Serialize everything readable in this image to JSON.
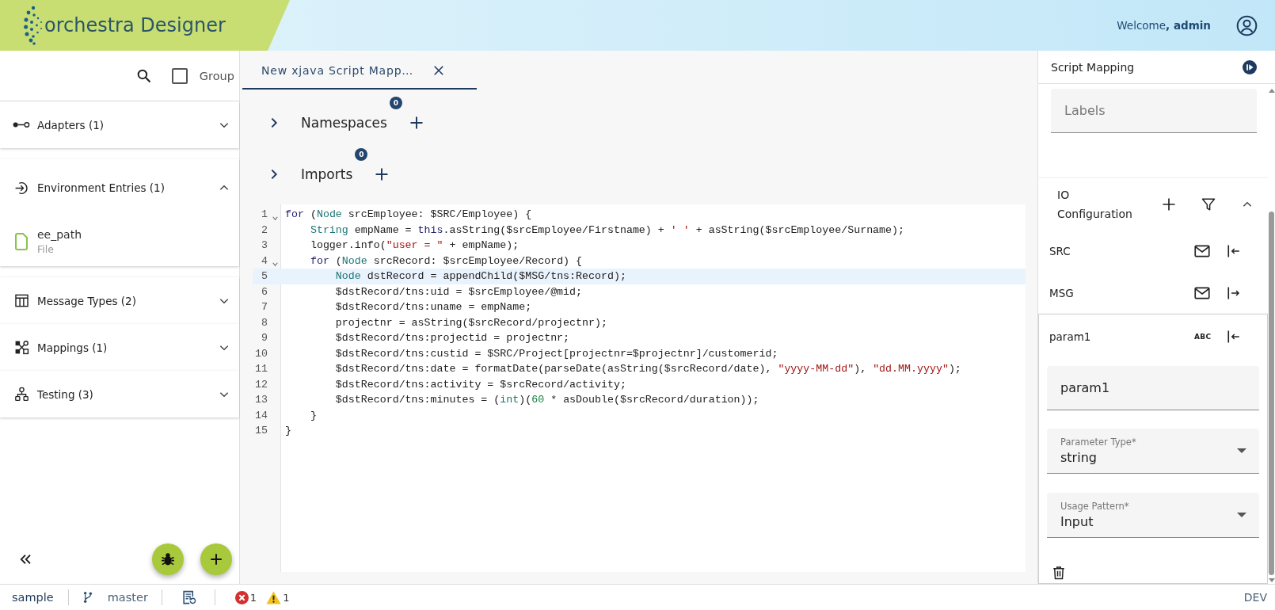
{
  "header": {
    "app_name": "orchestra Designer",
    "welcome": "Welcome**, admin**"
  },
  "sidebar": {
    "group_toggle": {
      "label": "Group",
      "checked": false
    },
    "sections": [
      {
        "title": "Adapters (1)",
        "expanded": false
      },
      {
        "title": "Environment Entries (1)",
        "expanded": true,
        "entries": [
          {
            "name": "ee_path",
            "type": "File"
          }
        ]
      },
      {
        "title": "Message Types (2)",
        "expanded": false
      },
      {
        "title": "Mappings (1)",
        "expanded": false
      },
      {
        "title": "Testing (3)",
        "expanded": false
      }
    ]
  },
  "editor": {
    "tabs": [
      {
        "label": "New xjava Script Mapp…",
        "selected": true
      }
    ],
    "sections": [
      {
        "label": "Namespaces",
        "count": "0",
        "expanded": false
      },
      {
        "label": "Imports",
        "count": "0",
        "expanded": false
      }
    ],
    "lines": [
      {
        "number": "1",
        "foldable": true,
        "active": false,
        "tokens": [
          {
            "text": "for",
            "kind": "keyword"
          },
          {
            "text": " (",
            "kind": "plain"
          },
          {
            "text": "Node",
            "kind": "type"
          },
          {
            "text": " srcEmployee: $SRC/Employee) {",
            "kind": "plain"
          }
        ]
      },
      {
        "number": "2",
        "foldable": false,
        "active": false,
        "tokens": [
          {
            "text": "    String",
            "kind": "type"
          },
          {
            "text": " empName = ",
            "kind": "plain"
          },
          {
            "text": "this",
            "kind": "keyword"
          },
          {
            "text": ".asString($srcEmployee/Firstname) + ",
            "kind": "plain"
          },
          {
            "text": "' '",
            "kind": "string"
          },
          {
            "text": " + asString($srcEmployee/Surname);",
            "kind": "plain"
          }
        ]
      },
      {
        "number": "3",
        "foldable": false,
        "active": false,
        "tokens": [
          {
            "text": "    logger.info(",
            "kind": "plain"
          },
          {
            "text": "\"user = \"",
            "kind": "string"
          },
          {
            "text": " + empName);",
            "kind": "plain"
          }
        ]
      },
      {
        "number": "4",
        "foldable": true,
        "active": false,
        "tokens": [
          {
            "text": "    for",
            "kind": "keyword"
          },
          {
            "text": " (",
            "kind": "plain"
          },
          {
            "text": "Node",
            "kind": "type"
          },
          {
            "text": " srcRecord: $srcEmployee/Record) {",
            "kind": "plain"
          }
        ]
      },
      {
        "number": "5",
        "foldable": false,
        "active": true,
        "tokens": [
          {
            "text": "        Node",
            "kind": "type"
          },
          {
            "text": " dstRecord = appendChild($MSG/tns:Record);",
            "kind": "plain"
          }
        ]
      },
      {
        "number": "6",
        "foldable": false,
        "active": false,
        "tokens": [
          {
            "text": "        $dstRecord/tns:uid = $srcEmployee/@mid;",
            "kind": "plain"
          }
        ]
      },
      {
        "number": "7",
        "foldable": false,
        "active": false,
        "tokens": [
          {
            "text": "        $dstRecord/tns:uname = empName;",
            "kind": "plain"
          }
        ]
      },
      {
        "number": "8",
        "foldable": false,
        "active": false,
        "tokens": [
          {
            "text": "        projectnr = asString($srcRecord/projectnr);",
            "kind": "plain"
          }
        ]
      },
      {
        "number": "9",
        "foldable": false,
        "active": false,
        "tokens": [
          {
            "text": "        $dstRecord/tns:projectid = projectnr;",
            "kind": "plain"
          }
        ]
      },
      {
        "number": "10",
        "foldable": false,
        "active": false,
        "tokens": [
          {
            "text": "        $dstRecord/tns:custid = $SRC/Project[projectnr=$projectnr]/customerid;",
            "kind": "plain"
          }
        ]
      },
      {
        "number": "11",
        "foldable": false,
        "active": false,
        "tokens": [
          {
            "text": "        $dstRecord/tns:date = formatDate(parseDate(asString($srcRecord/date), ",
            "kind": "plain"
          },
          {
            "text": "\"yyyy-MM-dd\"",
            "kind": "string"
          },
          {
            "text": "), ",
            "kind": "plain"
          },
          {
            "text": "\"dd.MM.yyyy\"",
            "kind": "string"
          },
          {
            "text": ");",
            "kind": "plain"
          }
        ]
      },
      {
        "number": "12",
        "foldable": false,
        "active": false,
        "tokens": [
          {
            "text": "        $dstRecord/tns:activity = $srcRecord/activity;",
            "kind": "plain"
          }
        ]
      },
      {
        "number": "13",
        "foldable": false,
        "active": false,
        "tokens": [
          {
            "text": "        $dstRecord/tns:minutes = (",
            "kind": "plain"
          },
          {
            "text": "int",
            "kind": "type"
          },
          {
            "text": ")(",
            "kind": "plain"
          },
          {
            "text": "60",
            "kind": "number"
          },
          {
            "text": " * asDouble($srcRecord/duration));",
            "kind": "plain"
          }
        ]
      },
      {
        "number": "14",
        "foldable": false,
        "active": false,
        "tokens": [
          {
            "text": "    }",
            "kind": "plain"
          }
        ]
      },
      {
        "number": "15",
        "foldable": false,
        "active": false,
        "tokens": [
          {
            "text": "}",
            "kind": "plain"
          }
        ]
      }
    ]
  },
  "properties": {
    "title": "Script Mapping",
    "labels": {
      "placeholder": "Labels"
    },
    "io_configuration": {
      "title": "IO Configuration",
      "expanded": true,
      "items": [
        {
          "name": "SRC",
          "kind": "message",
          "outgoing": false,
          "expanded": false
        },
        {
          "name": "MSG",
          "kind": "message",
          "outgoing": true,
          "expanded": false
        },
        {
          "name": "param1",
          "kind": "string",
          "type_label": "ABC",
          "outgoing": false,
          "expanded": true,
          "details": {
            "name": {
              "value": "param1"
            },
            "parameter_type": {
              "label": "Parameter Type*",
              "value": "string"
            },
            "usage_pattern": {
              "label": "Usage Pattern*",
              "value": "Input"
            }
          }
        }
      ]
    }
  },
  "status_bar": {
    "project": "sample",
    "branch": "master",
    "errors": "1",
    "warnings": "1",
    "environment": "DEV"
  }
}
